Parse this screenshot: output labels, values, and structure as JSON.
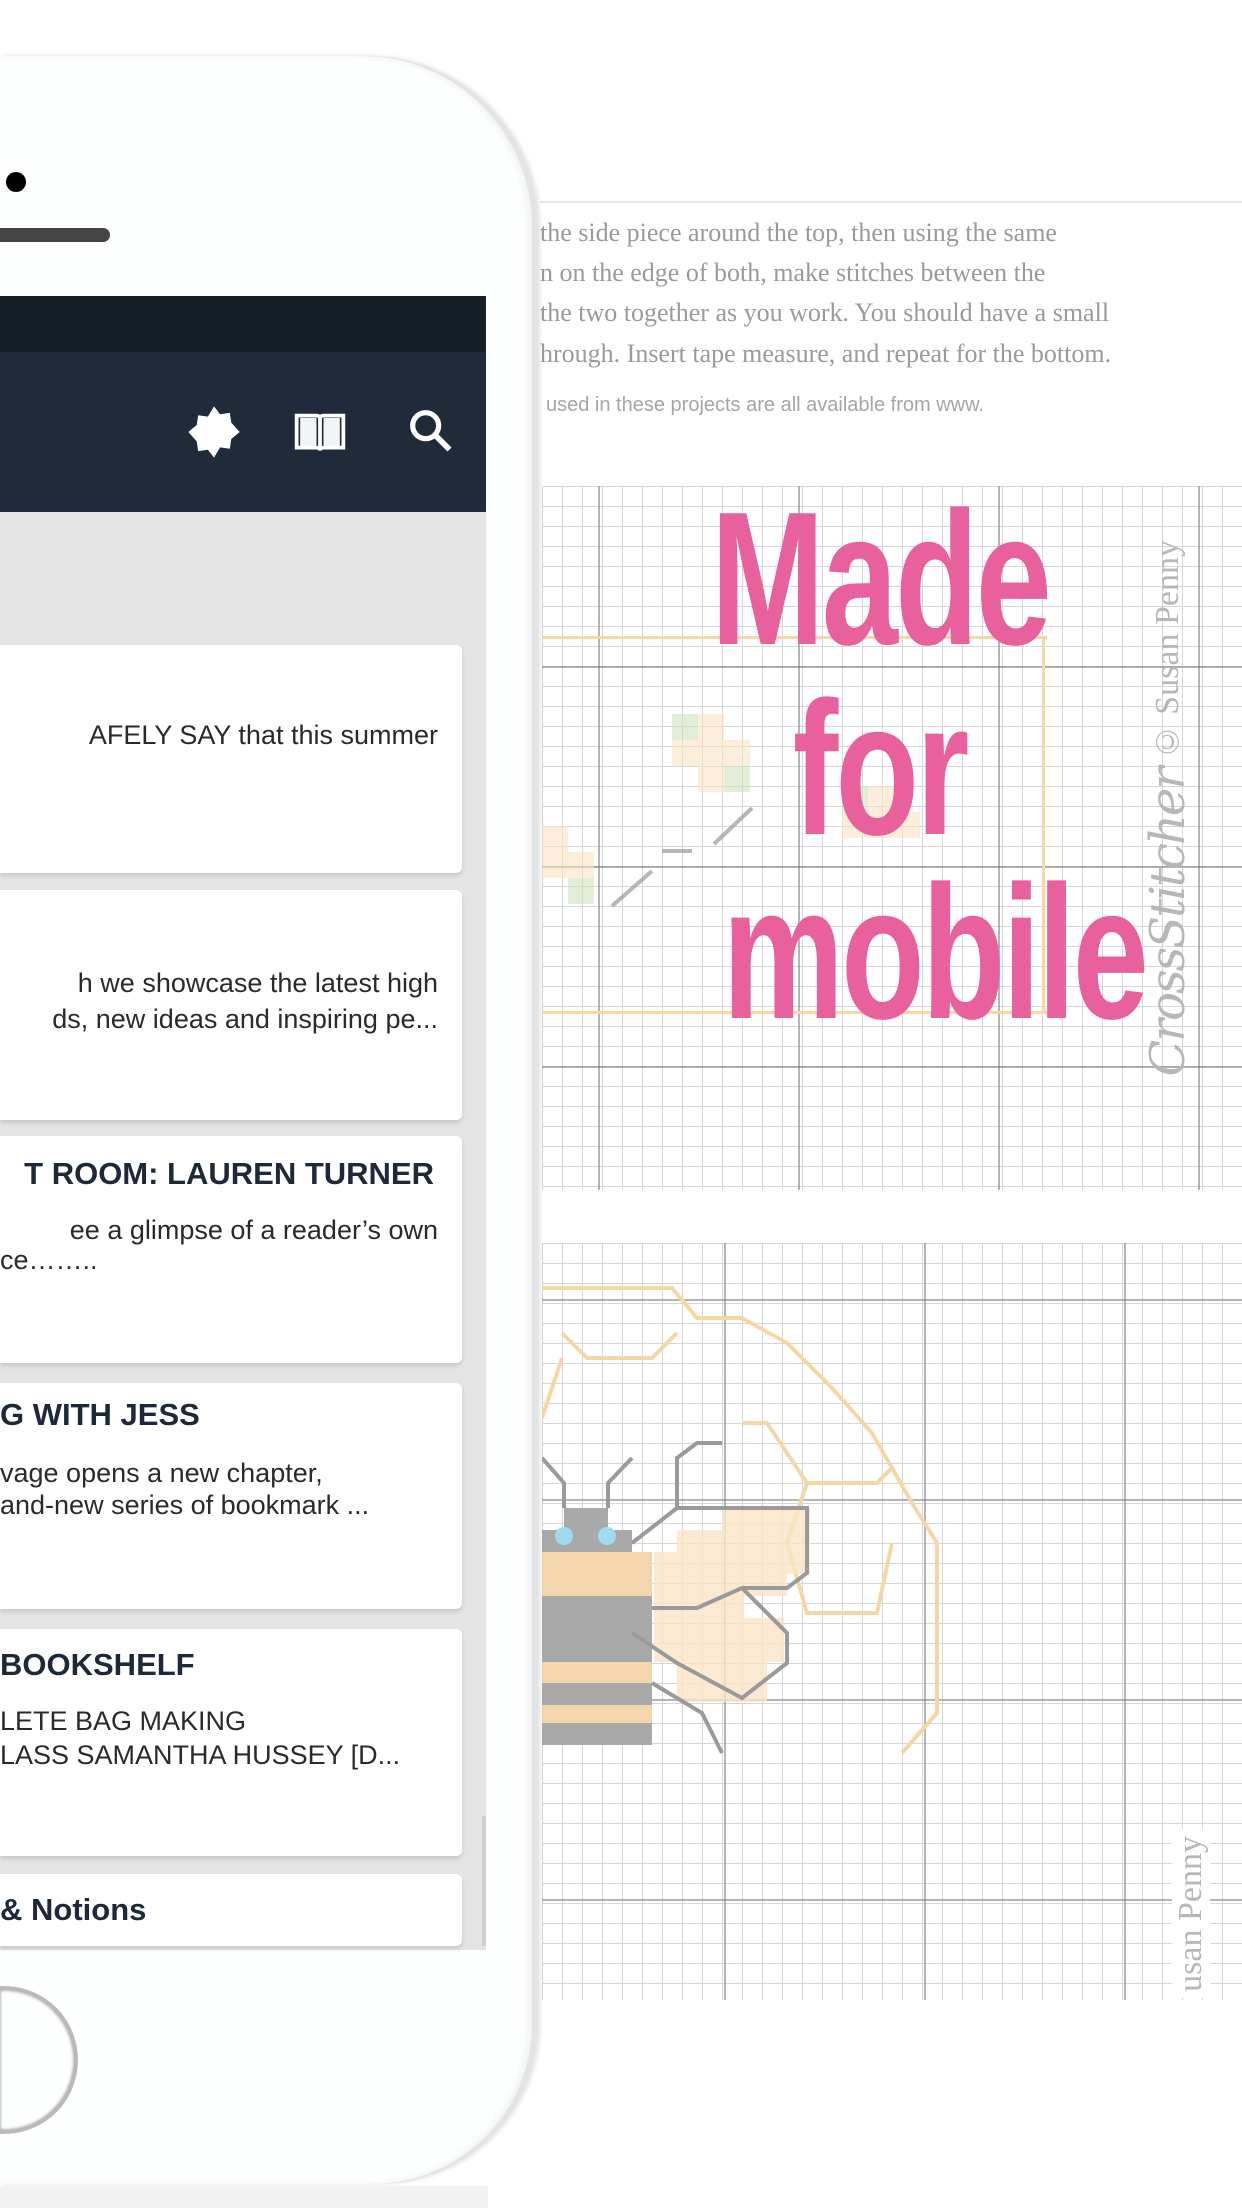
{
  "background_document": {
    "lines": [
      "the side piece around the top, then using the same",
      "n on the edge of both, make stitches between the",
      "the two together as you work. You should have a small",
      "hrough. Insert tape measure, and repeat for the bottom."
    ],
    "note": "used in these projects are all available from www."
  },
  "promo": {
    "lines": [
      "Made",
      "for",
      "mobile"
    ],
    "color": "#e8609c"
  },
  "watermark": {
    "brand": "CrossStitcher",
    "credit": "© Susan Penny",
    "credit_partial": "usan Penny"
  },
  "app": {
    "header_color": "#1f2b3a",
    "status_color": "#161e26",
    "icons": [
      "brightness-night-mode-icon",
      "book-open-icon",
      "search-icon"
    ],
    "articles": [
      {
        "title": "",
        "summary": [
          "AFELY SAY that this summer"
        ]
      },
      {
        "title": "",
        "summary": [
          "h we showcase the latest high",
          "ds, new ideas and inspiring pe..."
        ]
      },
      {
        "title": "T ROOM: LAUREN TURNER",
        "summary": [
          "ee a glimpse of a reader’s own",
          "ce…….."
        ]
      },
      {
        "title": "G WITH JESS",
        "summary": [
          "vage opens a new chapter,",
          "and-new series of bookmark ..."
        ]
      },
      {
        "title": "BOOKSHELF",
        "summary": [
          "LETE BAG MAKING",
          "LASS SAMANTHA HUSSEY [D..."
        ]
      },
      {
        "title": "& Notions",
        "summary": []
      }
    ]
  }
}
